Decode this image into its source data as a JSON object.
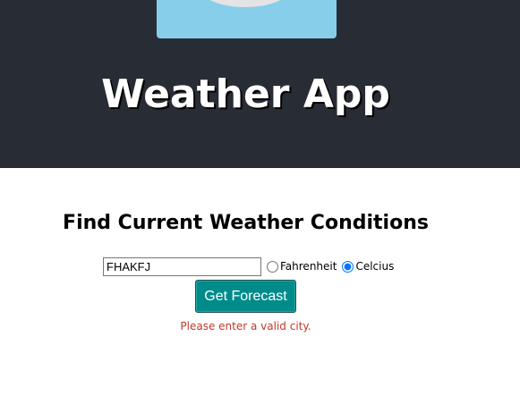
{
  "header": {
    "title": "Weather App",
    "background_color": "#282c34",
    "logo_background_color": "#87ceeb",
    "logo_name": "weather-logo-icon"
  },
  "form": {
    "heading": "Find Current Weather Conditions",
    "city_value": "FHAKFJ",
    "unit_options": [
      {
        "label": "Fahrenheit",
        "checked": false
      },
      {
        "label": "Celcius",
        "checked": true
      }
    ],
    "submit_label": "Get Forecast",
    "submit_color": "#008b8b",
    "error_message": "Please enter a valid city.",
    "error_color": "#c0392b"
  }
}
